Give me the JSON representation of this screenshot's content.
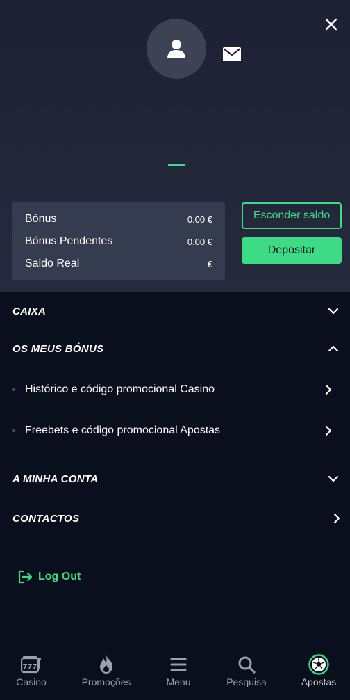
{
  "profile": {
    "avatar_icon": "user-icon",
    "mail_icon": "mail-icon",
    "close_icon": "close-icon"
  },
  "balance": {
    "rows": [
      {
        "label": "Bónus",
        "value": "0.00 €"
      },
      {
        "label": "Bónus Pendentes",
        "value": "0.00 €"
      },
      {
        "label": "Saldo Real",
        "value": "€"
      }
    ],
    "hide_button": "Esconder saldo",
    "deposit_button": "Depositar"
  },
  "menu": {
    "caixa": "CAIXA",
    "bonus": "OS MEUS BÓNUS",
    "bonus_items": [
      "Histórico e código promocional Casino",
      "Freebets e código promocional Apostas"
    ],
    "conta": "A MINHA CONTA",
    "contactos": "CONTACTOS",
    "logout": "Log Out"
  },
  "bottom_nav": {
    "items": [
      {
        "label": "Casino",
        "icon": "slot-machine-icon"
      },
      {
        "label": "Promoções",
        "icon": "flame-icon"
      },
      {
        "label": "Menu",
        "icon": "menu-icon"
      },
      {
        "label": "Pesquisa",
        "icon": "search-icon"
      },
      {
        "label": "Apostas",
        "icon": "soccer-ball-icon"
      }
    ]
  },
  "colors": {
    "accent": "#3ddc84",
    "background": "#0a0f1e",
    "panel": "#363c4f"
  }
}
